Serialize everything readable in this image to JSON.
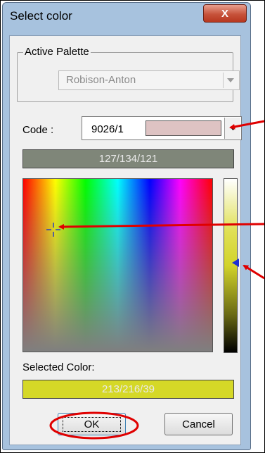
{
  "window": {
    "title": "Select color",
    "close_glyph": "X"
  },
  "active_palette": {
    "group_label": "Active Palette",
    "selected_value": "Robison-Anton"
  },
  "code": {
    "label": "Code :",
    "value": "9026/1",
    "swatch_color": "#dec3c3"
  },
  "current_rgb": {
    "text": "127/134/121",
    "color": "#7f8679"
  },
  "selected_color": {
    "label": "Selected Color:",
    "text": "213/216/39",
    "color": "#d5d827"
  },
  "buttons": {
    "ok_label": "OK",
    "cancel_label": "Cancel"
  },
  "annotation_color": "#e00000",
  "icons": [
    "close-icon",
    "dropdown-arrow-icon",
    "crosshair-icon",
    "slider-marker-icon"
  ]
}
